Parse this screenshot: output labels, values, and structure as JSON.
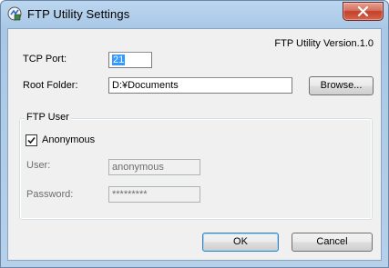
{
  "window": {
    "title": "FTP Utility Settings",
    "icon": "ftp-app-icon"
  },
  "version_label": "FTP Utility Version.1.0",
  "tcp_port": {
    "label": "TCP Port:",
    "value": "21"
  },
  "root_folder": {
    "label": "Root Folder:",
    "value": "D:¥Documents",
    "browse_label": "Browse..."
  },
  "ftp_user": {
    "group_title": "FTP User",
    "anonymous_label": "Anonymous",
    "anonymous_checked": true,
    "user_label": "User:",
    "user_value": "anonymous",
    "password_label": "Password:",
    "password_value": "*********"
  },
  "buttons": {
    "ok": "OK",
    "cancel": "Cancel"
  },
  "colors": {
    "titlebar": "#bcd6ef",
    "close_button": "#c2412b",
    "dialog_bg": "#f0f0f0",
    "selection": "#3399ff"
  }
}
